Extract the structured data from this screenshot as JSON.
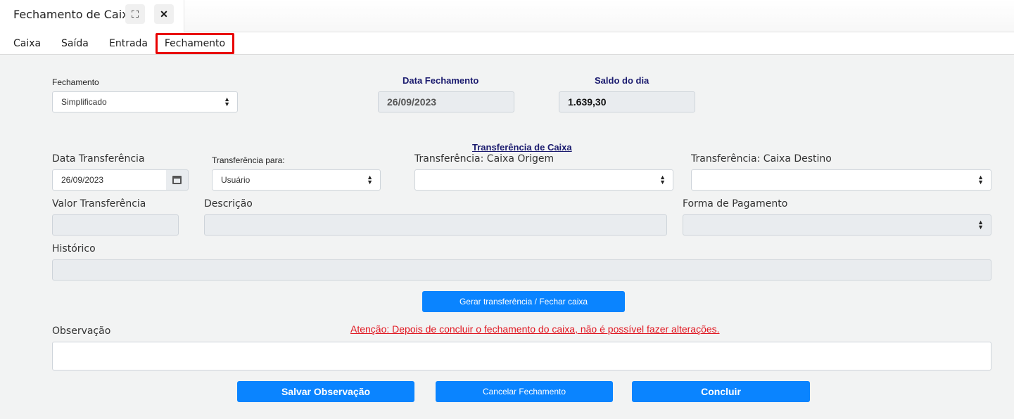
{
  "window": {
    "title": "Fechamento de Caixa",
    "expand_glyph": "⛶",
    "close_glyph": "✕"
  },
  "tabs": [
    "Caixa",
    "Saída",
    "Entrada",
    "Fechamento"
  ],
  "fechamento": {
    "label": "Fechamento",
    "value": "Simplificado"
  },
  "data_fechamento": {
    "label": "Data Fechamento",
    "value": "26/09/2023"
  },
  "saldo_dia": {
    "label": "Saldo do dia",
    "value": "1.639,30"
  },
  "transferencia": {
    "section_title": "Transferência de Caixa",
    "data_label": "Data Transferência",
    "data_value": "26/09/2023",
    "para_label": "Transferência para:",
    "para_value": "Usuário",
    "origem_label": "Transferência: Caixa Origem",
    "origem_value": "",
    "destino_label": "Transferência: Caixa Destino",
    "destino_value": "",
    "valor_label": "Valor Transferência",
    "descricao_label": "Descrição",
    "forma_label": "Forma de Pagamento",
    "historico_label": "Histórico",
    "generate_button": "Gerar transferência / Fechar caixa"
  },
  "observacao": {
    "label": "Observação",
    "warning": "Atenção: Depois de concluir o fechamento do caixa, não é possível fazer alterações."
  },
  "actions": {
    "salvar": "Salvar Observação",
    "cancelar": "Cancelar Fechamento",
    "concluir": "Concluir"
  },
  "colors": {
    "primary": "#0a84ff",
    "warning": "#e0141e",
    "heading": "#1a1a6e",
    "active_tab_border": "#e80000"
  }
}
